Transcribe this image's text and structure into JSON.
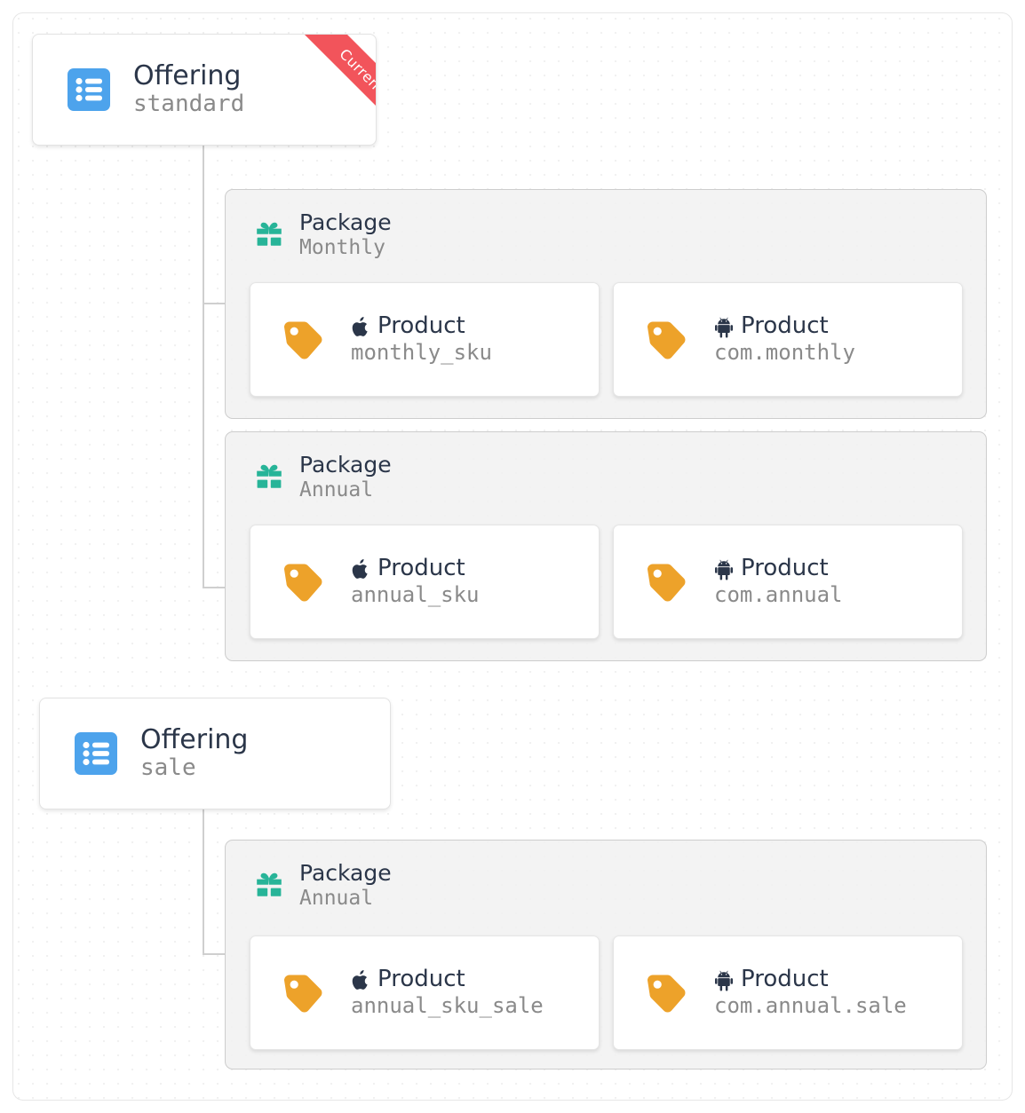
{
  "colors": {
    "offering_icon": "#4da3ec",
    "package_icon": "#27b498",
    "product_icon": "#eda22a",
    "ribbon": "#f2545b",
    "title_text": "#2b3649",
    "sub_text": "#8a8a8a",
    "connector": "#cfcfcf"
  },
  "labels": {
    "offering": "Offering",
    "package": "Package",
    "product": "Product"
  },
  "offerings": [
    {
      "type_label": "Offering",
      "identifier": "standard",
      "badge": "Current",
      "packages": [
        {
          "type_label": "Package",
          "identifier": "Monthly",
          "products": [
            {
              "type_label": "Product",
              "identifier": "monthly_sku",
              "platform": "apple-icon"
            },
            {
              "type_label": "Product",
              "identifier": "com.monthly",
              "platform": "android-icon"
            }
          ]
        },
        {
          "type_label": "Package",
          "identifier": "Annual",
          "products": [
            {
              "type_label": "Product",
              "identifier": "annual_sku",
              "platform": "apple-icon"
            },
            {
              "type_label": "Product",
              "identifier": "com.annual",
              "platform": "android-icon"
            }
          ]
        }
      ]
    },
    {
      "type_label": "Offering",
      "identifier": "sale",
      "badge": null,
      "packages": [
        {
          "type_label": "Package",
          "identifier": "Annual",
          "products": [
            {
              "type_label": "Product",
              "identifier": "annual_sku_sale",
              "platform": "apple-icon"
            },
            {
              "type_label": "Product",
              "identifier": "com.annual.sale",
              "platform": "android-icon"
            }
          ]
        }
      ]
    }
  ]
}
